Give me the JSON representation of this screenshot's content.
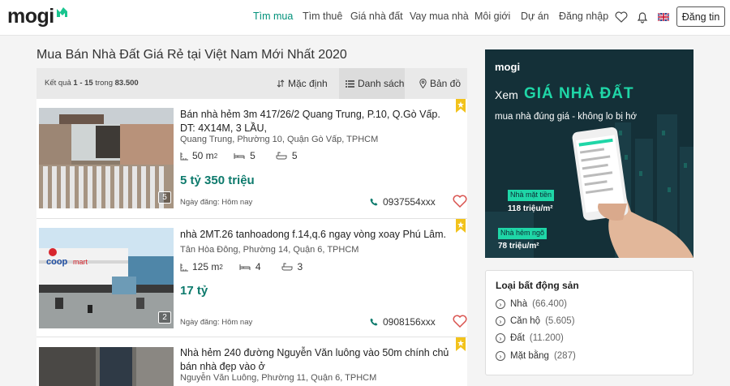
{
  "header": {
    "logo": "mogi",
    "nav": [
      "Tìm mua",
      "Tìm thuê",
      "Giá nhà đất",
      "Vay mua nhà",
      "Môi giới",
      "Dự án",
      "Đăng nhập"
    ],
    "post_button": "Đăng tin"
  },
  "main": {
    "title": "Mua Bán Nhà Đất Giá Rẻ tại Việt Nam Mới Nhất 2020",
    "result_prefix": "Kết quả",
    "result_range": "1 - 15",
    "result_mid": "trong",
    "result_total": "83.500",
    "views": [
      "Mặc định",
      "Danh sách",
      "Bản đồ"
    ]
  },
  "listings": [
    {
      "title": "Bán nhà hẻm 3m 417/26/2 Quang Trung, P.10, Q.Gò Vấp. DT: 4X14M, 3 LẦU,",
      "address": "Quang Trung, Phường 10, Quận Gò Vấp, TPHCM",
      "area": "50 m",
      "area_sup": "2",
      "bedrooms": "5",
      "bathrooms": "5",
      "price": "5 tỷ 350 triệu",
      "date": "Ngày đăng: Hôm nay",
      "phone": "0937554xxx",
      "image_count": "5"
    },
    {
      "title": "nhà 2MT.26 tanhoadong f.14,q.6 ngay vòng xoay Phú Lâm.",
      "address": "Tân Hòa Đông, Phường 14, Quận 6, TPHCM",
      "area": "125 m",
      "area_sup": "2",
      "bedrooms": "4",
      "bathrooms": "3",
      "price": "17 tỷ",
      "date": "Ngày đăng: Hôm nay",
      "phone": "0908156xxx",
      "image_count": "2"
    },
    {
      "title": "Nhà hẻm 240 đường Nguyễn Văn luông vào 50m chính chủ bán nhà đẹp vào ở",
      "address": "Nguyễn Văn Luông, Phường 11, Quận 6, TPHCM"
    }
  ],
  "ad": {
    "brand": "mogi",
    "xem": "Xem",
    "headline": "GIÁ NHÀ ĐẤT",
    "subline": "mua nhà đúng giá - không lo bị hớ",
    "tag1": "Nhà mặt tiền",
    "price1": "118 triệu/m²",
    "tag2": "Nhà hẻm ngõ",
    "price2": "78 triệu/m²"
  },
  "filter": {
    "title": "Loại bất động sản",
    "items": [
      {
        "label": "Nhà",
        "count": "(66.400)"
      },
      {
        "label": "Căn hộ",
        "count": "(5.605)"
      },
      {
        "label": "Đất",
        "count": "(11.200)"
      },
      {
        "label": "Mặt bằng",
        "count": "(287)"
      }
    ]
  },
  "colors": {
    "accent": "#00917a",
    "price": "#0d7a6c",
    "bookmark": "#f2c21b",
    "heart": "#d9534f"
  }
}
